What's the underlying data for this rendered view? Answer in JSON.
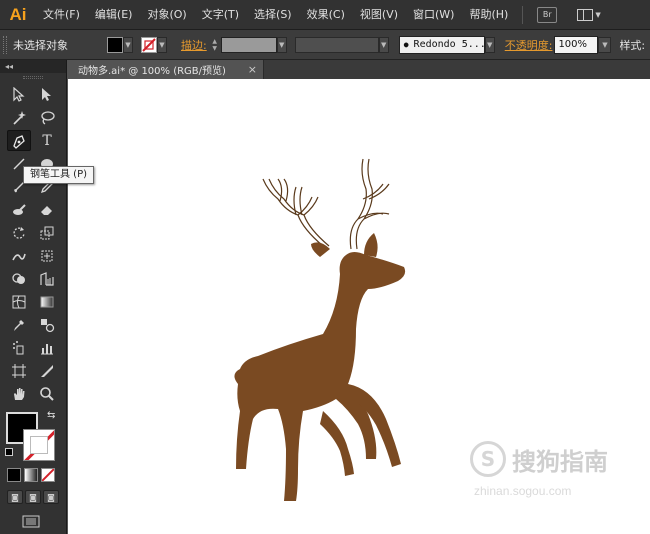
{
  "app": {
    "logo": "Ai",
    "brand_color": "#f7a21d"
  },
  "menubar": {
    "items": [
      "文件(F)",
      "编辑(E)",
      "对象(O)",
      "文字(T)",
      "选择(S)",
      "效果(C)",
      "视图(V)",
      "窗口(W)",
      "帮助(H)"
    ],
    "bridge_label": "Br"
  },
  "controlbar": {
    "selection": "未选择对象",
    "stroke_label": "描边:",
    "brush": "Redondo 5...",
    "opacity_label": "不透明度:",
    "opacity_value": "100%",
    "style_label": "样式:"
  },
  "toolbox": {
    "header": "◂◂",
    "tooltip": "钢笔工具 (P)",
    "active_tool": "pen-tool",
    "fill_color": "#000000",
    "stroke_color": "none"
  },
  "document": {
    "tab_title": "动物多.ai* @ 100% (RGB/预览)",
    "close_glyph": "×"
  },
  "artwork": {
    "deer_color": "#7a4a22",
    "antler_stroke": "#5a3a1c"
  },
  "watermark": {
    "brand": "搜狗指南",
    "url": "zhinan.sogou.com"
  }
}
